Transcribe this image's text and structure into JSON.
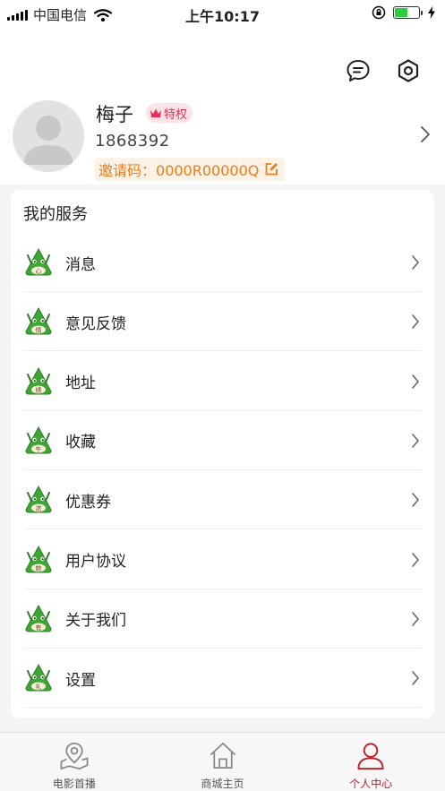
{
  "status_bar": {
    "carrier": "中国电信",
    "time": "上午10:17"
  },
  "header": {
    "message_icon": "chat-bubble-icon",
    "settings_icon": "hexagon-settings-icon",
    "user_name": "梅子",
    "badge_label": "特权",
    "phone": "1868392",
    "invite_label": "邀请码：",
    "invite_code": "0000R00000Q"
  },
  "services": {
    "title": "我的服务",
    "items": [
      {
        "label": "消息",
        "glyph": "心"
      },
      {
        "label": "意见反馈",
        "glyph": "情"
      },
      {
        "label": "地址",
        "glyph": "绣"
      },
      {
        "label": "收藏",
        "glyph": "午"
      },
      {
        "label": "优惠券",
        "glyph": "浓"
      },
      {
        "label": "用户协议",
        "glyph": "粽"
      },
      {
        "label": "关于我们",
        "glyph": "有"
      },
      {
        "label": "设置",
        "glyph": "礼"
      }
    ]
  },
  "tabbar": {
    "tabs": [
      {
        "label": "电影首播",
        "icon": "map-pin-icon"
      },
      {
        "label": "商城主页",
        "icon": "home-icon"
      },
      {
        "label": "个人中心",
        "icon": "user-icon"
      }
    ],
    "active_index": 2
  },
  "colors": {
    "accent": "#c0202e",
    "invite_text": "#e87d1e",
    "badge": "#e8305a",
    "mascot_green": "#3fa535"
  }
}
